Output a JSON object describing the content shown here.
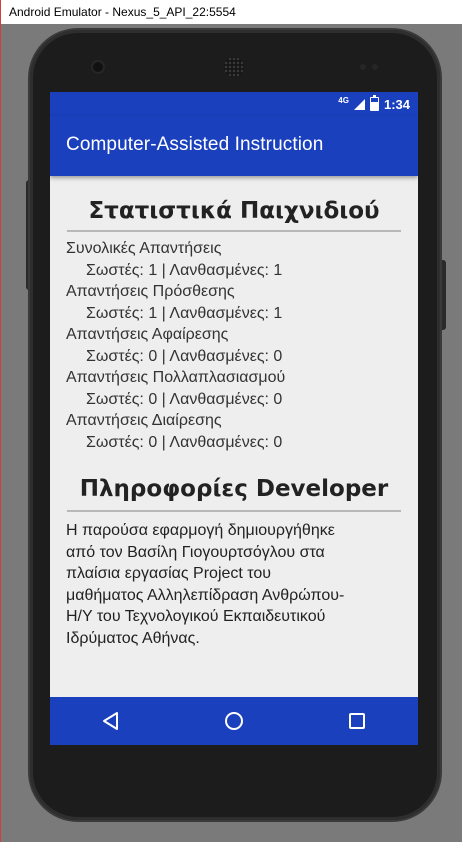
{
  "window": {
    "title": "Android Emulator - Nexus_5_API_22:5554"
  },
  "status_bar": {
    "network": "4G",
    "time": "1:34"
  },
  "app_bar": {
    "title": "Computer-Assisted Instruction"
  },
  "stats_section": {
    "title": "Στατιστικά Παιχνιδιού",
    "items": [
      {
        "heading": "Συνολικές Απαντήσεις",
        "value": "Σωστές: 1 | Λανθασμένες: 1"
      },
      {
        "heading": "Απαντήσεις Πρόσθεσης",
        "value": "Σωστές: 1 | Λανθασμένες: 1"
      },
      {
        "heading": "Απαντήσεις Αφαίρεσης",
        "value": "Σωστές: 0 | Λανθασμένες: 0"
      },
      {
        "heading": "Απαντήσεις Πολλαπλασιασμού",
        "value": "Σωστές: 0 | Λανθασμένες: 0"
      },
      {
        "heading": "Απαντήσεις Διαίρεσης",
        "value": "Σωστές: 0 | Λανθασμένες: 0"
      }
    ]
  },
  "developer_section": {
    "title": "Πληροφορίες Developer",
    "lines": [
      "Η παρούσα εφαρμογή δημιουργήθηκε",
      "από τον Βασίλη Γιογουρτσόγλου στα",
      "πλαίσια εργασίας Project του",
      "μαθήματος Αλληλεπίδραση Ανθρώπου-",
      "Η/Υ του Τεχνολογικού Εκπαιδευτικού",
      "Ιδρύματος Αθήνας."
    ]
  },
  "nav_bar": {
    "icons": [
      "back-icon",
      "home-icon",
      "recents-icon"
    ]
  },
  "colors": {
    "primary": "#1a40bd",
    "background": "#eeeeee",
    "divider": "#b8b8b8",
    "text": "#333333"
  }
}
